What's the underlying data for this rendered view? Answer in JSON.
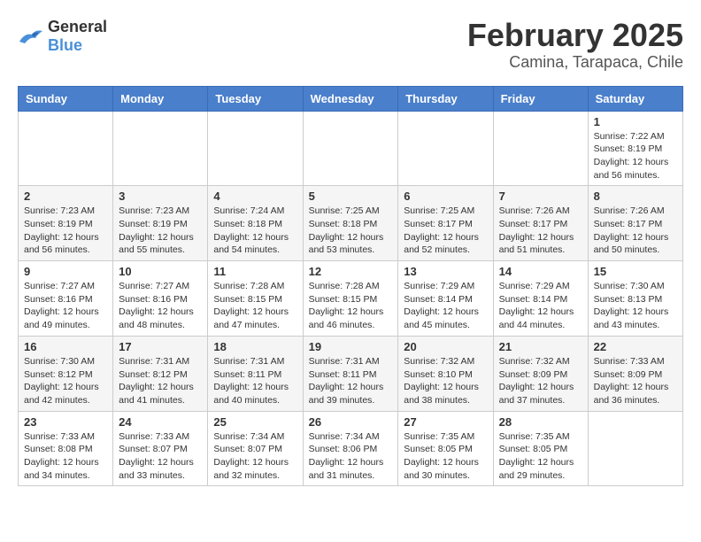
{
  "logo": {
    "general": "General",
    "blue": "Blue"
  },
  "header": {
    "month": "February 2025",
    "location": "Camina, Tarapaca, Chile"
  },
  "weekdays": [
    "Sunday",
    "Monday",
    "Tuesday",
    "Wednesday",
    "Thursday",
    "Friday",
    "Saturday"
  ],
  "weeks": [
    [
      {
        "day": "",
        "info": ""
      },
      {
        "day": "",
        "info": ""
      },
      {
        "day": "",
        "info": ""
      },
      {
        "day": "",
        "info": ""
      },
      {
        "day": "",
        "info": ""
      },
      {
        "day": "",
        "info": ""
      },
      {
        "day": "1",
        "info": "Sunrise: 7:22 AM\nSunset: 8:19 PM\nDaylight: 12 hours\nand 56 minutes."
      }
    ],
    [
      {
        "day": "2",
        "info": "Sunrise: 7:23 AM\nSunset: 8:19 PM\nDaylight: 12 hours\nand 56 minutes."
      },
      {
        "day": "3",
        "info": "Sunrise: 7:23 AM\nSunset: 8:19 PM\nDaylight: 12 hours\nand 55 minutes."
      },
      {
        "day": "4",
        "info": "Sunrise: 7:24 AM\nSunset: 8:18 PM\nDaylight: 12 hours\nand 54 minutes."
      },
      {
        "day": "5",
        "info": "Sunrise: 7:25 AM\nSunset: 8:18 PM\nDaylight: 12 hours\nand 53 minutes."
      },
      {
        "day": "6",
        "info": "Sunrise: 7:25 AM\nSunset: 8:17 PM\nDaylight: 12 hours\nand 52 minutes."
      },
      {
        "day": "7",
        "info": "Sunrise: 7:26 AM\nSunset: 8:17 PM\nDaylight: 12 hours\nand 51 minutes."
      },
      {
        "day": "8",
        "info": "Sunrise: 7:26 AM\nSunset: 8:17 PM\nDaylight: 12 hours\nand 50 minutes."
      }
    ],
    [
      {
        "day": "9",
        "info": "Sunrise: 7:27 AM\nSunset: 8:16 PM\nDaylight: 12 hours\nand 49 minutes."
      },
      {
        "day": "10",
        "info": "Sunrise: 7:27 AM\nSunset: 8:16 PM\nDaylight: 12 hours\nand 48 minutes."
      },
      {
        "day": "11",
        "info": "Sunrise: 7:28 AM\nSunset: 8:15 PM\nDaylight: 12 hours\nand 47 minutes."
      },
      {
        "day": "12",
        "info": "Sunrise: 7:28 AM\nSunset: 8:15 PM\nDaylight: 12 hours\nand 46 minutes."
      },
      {
        "day": "13",
        "info": "Sunrise: 7:29 AM\nSunset: 8:14 PM\nDaylight: 12 hours\nand 45 minutes."
      },
      {
        "day": "14",
        "info": "Sunrise: 7:29 AM\nSunset: 8:14 PM\nDaylight: 12 hours\nand 44 minutes."
      },
      {
        "day": "15",
        "info": "Sunrise: 7:30 AM\nSunset: 8:13 PM\nDaylight: 12 hours\nand 43 minutes."
      }
    ],
    [
      {
        "day": "16",
        "info": "Sunrise: 7:30 AM\nSunset: 8:12 PM\nDaylight: 12 hours\nand 42 minutes."
      },
      {
        "day": "17",
        "info": "Sunrise: 7:31 AM\nSunset: 8:12 PM\nDaylight: 12 hours\nand 41 minutes."
      },
      {
        "day": "18",
        "info": "Sunrise: 7:31 AM\nSunset: 8:11 PM\nDaylight: 12 hours\nand 40 minutes."
      },
      {
        "day": "19",
        "info": "Sunrise: 7:31 AM\nSunset: 8:11 PM\nDaylight: 12 hours\nand 39 minutes."
      },
      {
        "day": "20",
        "info": "Sunrise: 7:32 AM\nSunset: 8:10 PM\nDaylight: 12 hours\nand 38 minutes."
      },
      {
        "day": "21",
        "info": "Sunrise: 7:32 AM\nSunset: 8:09 PM\nDaylight: 12 hours\nand 37 minutes."
      },
      {
        "day": "22",
        "info": "Sunrise: 7:33 AM\nSunset: 8:09 PM\nDaylight: 12 hours\nand 36 minutes."
      }
    ],
    [
      {
        "day": "23",
        "info": "Sunrise: 7:33 AM\nSunset: 8:08 PM\nDaylight: 12 hours\nand 34 minutes."
      },
      {
        "day": "24",
        "info": "Sunrise: 7:33 AM\nSunset: 8:07 PM\nDaylight: 12 hours\nand 33 minutes."
      },
      {
        "day": "25",
        "info": "Sunrise: 7:34 AM\nSunset: 8:07 PM\nDaylight: 12 hours\nand 32 minutes."
      },
      {
        "day": "26",
        "info": "Sunrise: 7:34 AM\nSunset: 8:06 PM\nDaylight: 12 hours\nand 31 minutes."
      },
      {
        "day": "27",
        "info": "Sunrise: 7:35 AM\nSunset: 8:05 PM\nDaylight: 12 hours\nand 30 minutes."
      },
      {
        "day": "28",
        "info": "Sunrise: 7:35 AM\nSunset: 8:05 PM\nDaylight: 12 hours\nand 29 minutes."
      },
      {
        "day": "",
        "info": ""
      }
    ]
  ]
}
